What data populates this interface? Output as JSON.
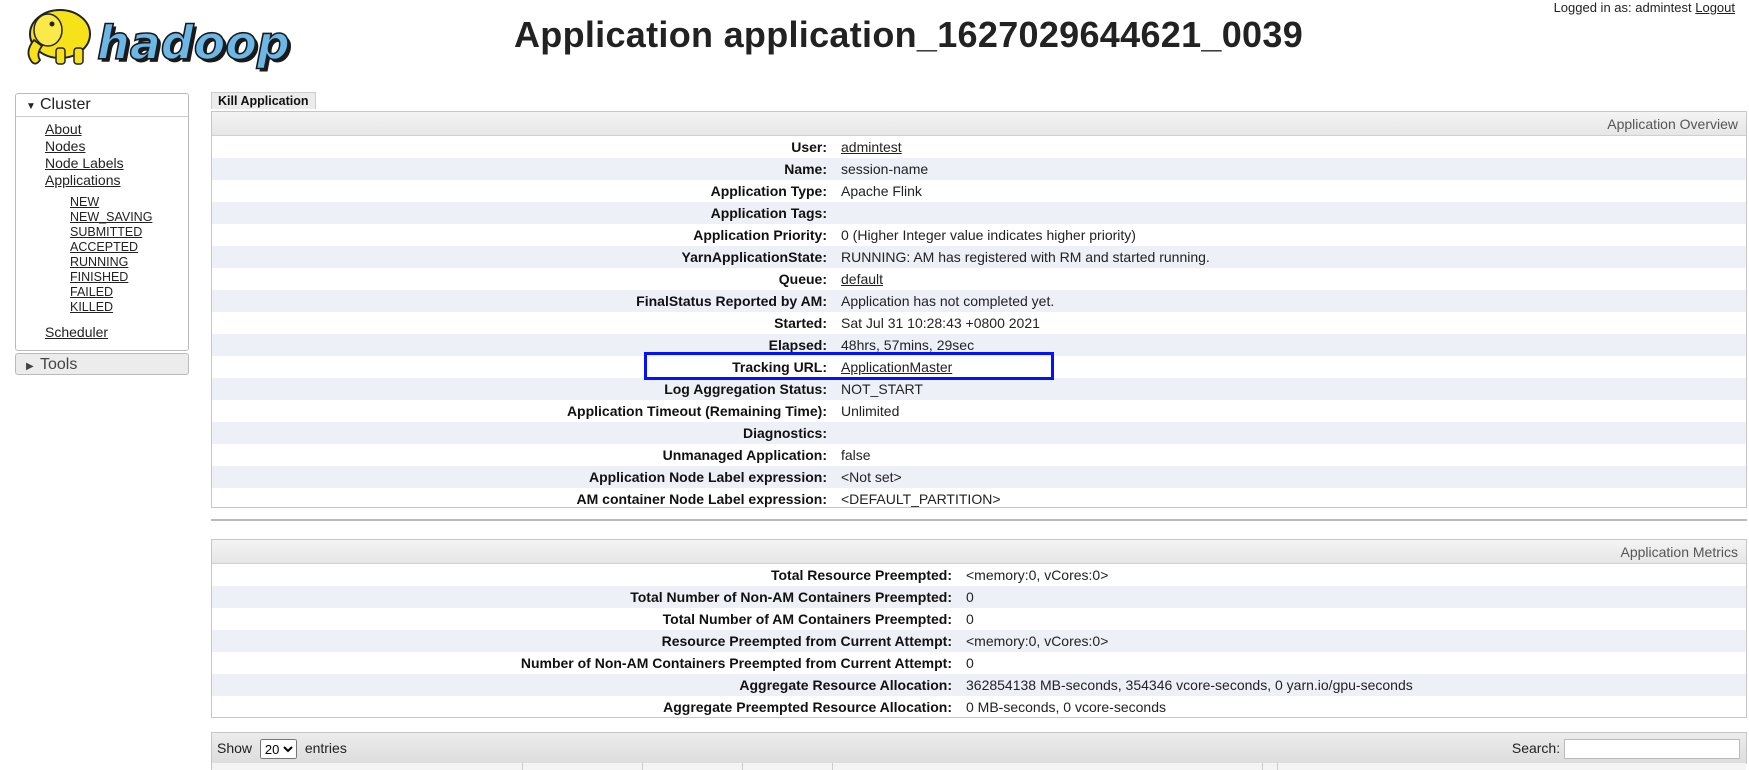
{
  "header": {
    "title": "Application application_1627029644621_0039",
    "logo_text": "hadoop",
    "login_prefix": "Logged in as: admintest",
    "logout_label": "Logout"
  },
  "sidebar": {
    "cluster_label": "Cluster",
    "cluster_links": [
      "About",
      "Nodes",
      "Node Labels",
      "Applications"
    ],
    "app_states": [
      "NEW",
      "NEW_SAVING",
      "SUBMITTED",
      "ACCEPTED",
      "RUNNING",
      "FINISHED",
      "FAILED",
      "KILLED"
    ],
    "scheduler_label": "Scheduler",
    "tools_label": "Tools"
  },
  "kill_label": "Kill Application",
  "overview": {
    "title": "Application Overview",
    "rows": [
      {
        "label": "User:",
        "value": "admintest",
        "link": true
      },
      {
        "label": "Name:",
        "value": "session-name",
        "link": false
      },
      {
        "label": "Application Type:",
        "value": "Apache Flink",
        "link": false
      },
      {
        "label": "Application Tags:",
        "value": "",
        "link": false
      },
      {
        "label": "Application Priority:",
        "value": "0 (Higher Integer value indicates higher priority)",
        "link": false
      },
      {
        "label": "YarnApplicationState:",
        "value": "RUNNING: AM has registered with RM and started running.",
        "link": false
      },
      {
        "label": "Queue:",
        "value": "default",
        "link": true
      },
      {
        "label": "FinalStatus Reported by AM:",
        "value": "Application has not completed yet.",
        "link": false
      },
      {
        "label": "Started:",
        "value": "Sat Jul 31 10:28:43 +0800 2021",
        "link": false
      },
      {
        "label": "Elapsed:",
        "value": "48hrs, 57mins, 29sec",
        "link": false
      },
      {
        "label": "Tracking URL:",
        "value": "ApplicationMaster",
        "link": true
      },
      {
        "label": "Log Aggregation Status:",
        "value": "NOT_START",
        "link": false
      },
      {
        "label": "Application Timeout (Remaining Time):",
        "value": "Unlimited",
        "link": false
      },
      {
        "label": "Diagnostics:",
        "value": "",
        "link": false
      },
      {
        "label": "Unmanaged Application:",
        "value": "false",
        "link": false
      },
      {
        "label": "Application Node Label expression:",
        "value": "<Not set>",
        "link": false
      },
      {
        "label": "AM container Node Label expression:",
        "value": "<DEFAULT_PARTITION>",
        "link": false
      }
    ]
  },
  "metrics": {
    "title": "Application Metrics",
    "rows": [
      {
        "label": "Total Resource Preempted:",
        "value": "<memory:0, vCores:0>"
      },
      {
        "label": "Total Number of Non-AM Containers Preempted:",
        "value": "0"
      },
      {
        "label": "Total Number of AM Containers Preempted:",
        "value": "0"
      },
      {
        "label": "Resource Preempted from Current Attempt:",
        "value": "<memory:0, vCores:0>"
      },
      {
        "label": "Number of Non-AM Containers Preempted from Current Attempt:",
        "value": "0"
      },
      {
        "label": "Aggregate Resource Allocation:",
        "value": "362854138 MB-seconds, 354346 vcore-seconds, 0 yarn.io/gpu-seconds"
      },
      {
        "label": "Aggregate Preempted Resource Allocation:",
        "value": "0 MB-seconds, 0 vcore-seconds"
      }
    ]
  },
  "table_controls": {
    "show_label": "Show",
    "page_size": "20",
    "entries_label": "entries",
    "search_label": "Search:"
  },
  "colors": {
    "highlight": "#0012ff",
    "logo_yellow": "#f7e21a",
    "logo_blue": "#6ab7e8"
  }
}
